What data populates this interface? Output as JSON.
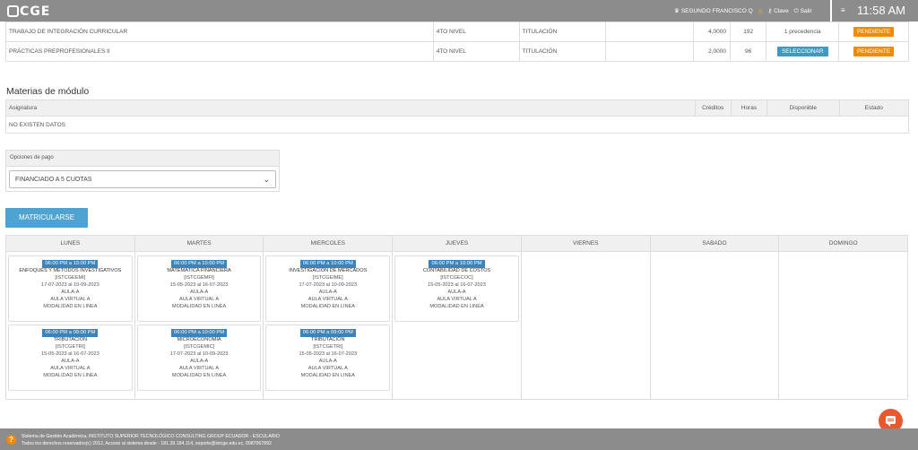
{
  "header": {
    "logo": "CGE",
    "user_name": "SEGUNDO FRANCISCO Q",
    "clave_label": "Clave",
    "salir_label": "Salir",
    "time": "11:58 AM"
  },
  "prior_rows": [
    {
      "asignatura": "TRABAJO DE INTEGRACIÓN CURRICULAR",
      "nivel": "4TO NIVEL",
      "tipo": "TITULACIÓN",
      "creditos": "4,0000",
      "horas": "192",
      "disponible": "1 precedencia",
      "estado": "PENDIENTE"
    },
    {
      "asignatura": "PRÁCTICAS PREPROFESIONALES II",
      "nivel": "4TO NIVEL",
      "tipo": "TITULACIÓN",
      "creditos": "2,0000",
      "horas": "96",
      "disponible": "SELECCIONAR",
      "estado": "PENDIENTE"
    }
  ],
  "modules": {
    "title": "Materias de módulo",
    "headers": {
      "asignatura": "Asignatura",
      "creditos": "Créditos",
      "horas": "Horas",
      "disponible": "Disponible",
      "estado": "Estado"
    },
    "empty": "NO EXISTEN DATOS"
  },
  "payment": {
    "label": "Opciones de pago",
    "selected": "FINANCIADO A 5 CUOTAS"
  },
  "enroll_label": "MATRICULARSE",
  "schedule": {
    "days": [
      "LUNES",
      "MARTES",
      "MIERCOLES",
      "JUEVES",
      "VIERNES",
      "SABADO",
      "DOMINGO"
    ],
    "events": {
      "lunes": [
        {
          "time": "06:00 PM a 10:00 PM",
          "title": "ENFOQUES Y MÉTODOS INVESTIGATIVOS",
          "code": "[ISTCGEEMI]",
          "dates": "17-07-2023 al 10-09-2023",
          "room": "AULA-A",
          "virtual": "AULA VIRTUAL A",
          "mode": "MODALIDAD EN LINEA"
        },
        {
          "time": "06:00 PM a 09:00 PM",
          "title": "TRIBUTACIÓN",
          "code": "[ISTCGETRI]",
          "dates": "15-05-2023 al 16-07-2023",
          "room": "AULA-A",
          "virtual": "AULA VIRTUAL A",
          "mode": "MODALIDAD EN LINEA"
        }
      ],
      "martes": [
        {
          "time": "06:00 PM a 10:00 PM",
          "title": "MATEMÁTICA FINANCIERA",
          "code": "[ISTCGEMFI]",
          "dates": "15-05-2023 al 16-07-2023",
          "room": "AULA-A",
          "virtual": "AULA VIRTUAL A",
          "mode": "MODALIDAD EN LINEA"
        },
        {
          "time": "06:00 PM a 10:00 PM",
          "title": "MICROECONOMÍA",
          "code": "[ISTCGEMIC]",
          "dates": "17-07-2023 al 10-09-2023",
          "room": "AULA-A",
          "virtual": "AULA VIRTUAL A",
          "mode": "MODALIDAD EN LINEA"
        }
      ],
      "miercoles": [
        {
          "time": "06:00 PM a 10:00 PM",
          "title": "INVESTIGACIÓN DE MERCADOS",
          "code": "[ISTCGEIME]",
          "dates": "17-07-2023 al 10-09-2023",
          "room": "AULA-A",
          "virtual": "AULA VIRTUAL A",
          "mode": "MODALIDAD EN LINEA"
        },
        {
          "time": "06:00 PM a 09:00 PM",
          "title": "TRIBUTACIÓN",
          "code": "[ISTCGETRI]",
          "dates": "15-05-2023 al 16-07-2023",
          "room": "AULA-A",
          "virtual": "AULA VIRTUAL A",
          "mode": "MODALIDAD EN LINEA"
        }
      ],
      "jueves": [
        {
          "time": "06:00 PM a 10:00 PM",
          "title": "CONTABILIDAD DE COSTOS",
          "code": "[ISTCGECOC]",
          "dates": "15-05-2023 al 16-07-2023",
          "room": "AULA-A",
          "virtual": "AULA VIRTUAL A",
          "mode": "MODALIDAD EN LINEA"
        }
      ]
    }
  },
  "footer": {
    "line1": "Sistema de Gestión Académica, INSTITUTO SUPERIOR TECNOLÓGICO CONSULTING GROUP ECUADOR - ESCULARIO",
    "line2": "Todos los derechos reservados(c) 2012, Acceso al sistema desde - 181.39.184.114, soporte@istcge.edu.ec, 0987067892"
  },
  "colors": {
    "accent": "#3b9cc2",
    "pending": "#f08a00",
    "topbar": "#8c8c8c",
    "chat": "#e9582e"
  }
}
